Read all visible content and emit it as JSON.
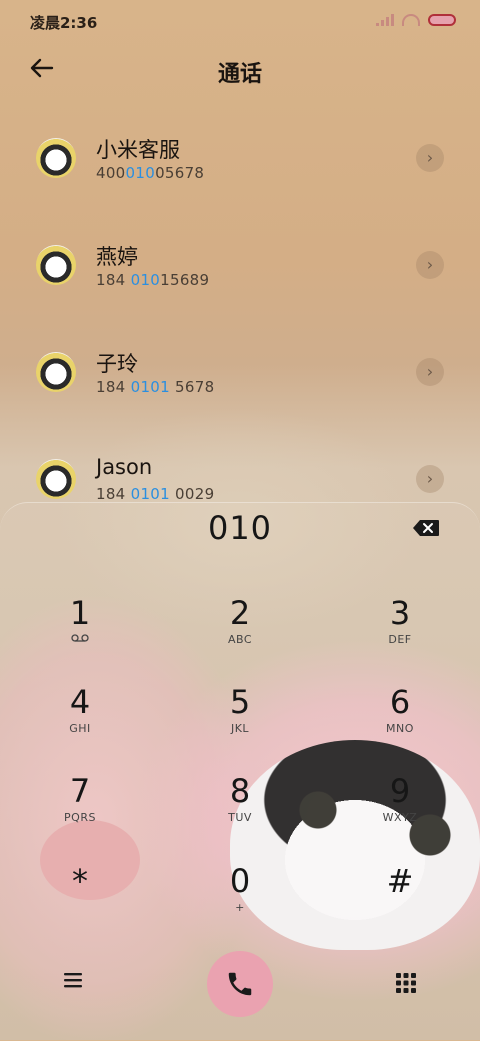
{
  "status_bar": {
    "time": "凌晨2:36"
  },
  "header": {
    "title": "通话"
  },
  "contacts": [
    {
      "name": "小米客服",
      "number_pre": "400",
      "number_hl": "010",
      "number_post": "05678"
    },
    {
      "name": "燕婷",
      "number_pre": "184 ",
      "number_hl": "010",
      "number_post": "15689"
    },
    {
      "name": "子玲",
      "number_pre": "184 ",
      "number_hl": "0101",
      "number_post": " 5678"
    },
    {
      "name": "Jason",
      "number_pre": "184 ",
      "number_hl": "0101",
      "number_post": " 0029"
    }
  ],
  "dialer": {
    "display": "010",
    "keys": [
      {
        "digit": "1",
        "letters": "voicemail"
      },
      {
        "digit": "2",
        "letters": "ABC"
      },
      {
        "digit": "3",
        "letters": "DEF"
      },
      {
        "digit": "4",
        "letters": "GHI"
      },
      {
        "digit": "5",
        "letters": "JKL"
      },
      {
        "digit": "6",
        "letters": "MNO"
      },
      {
        "digit": "7",
        "letters": "PQRS"
      },
      {
        "digit": "8",
        "letters": "TUV"
      },
      {
        "digit": "9",
        "letters": "WXYZ"
      },
      {
        "digit": "*",
        "letters": ""
      },
      {
        "digit": "0",
        "letters": "+"
      },
      {
        "digit": "#",
        "letters": ""
      }
    ]
  },
  "colors": {
    "highlight": "#2b8fe0",
    "call_button": "#eaa2b0"
  },
  "icons": {
    "back": "back-arrow-icon",
    "delete": "backspace-icon",
    "menu": "menu-icon",
    "call": "phone-icon",
    "keypad": "dialpad-icon",
    "chevron": "chevron-right-icon",
    "voicemail": "voicemail-icon"
  }
}
